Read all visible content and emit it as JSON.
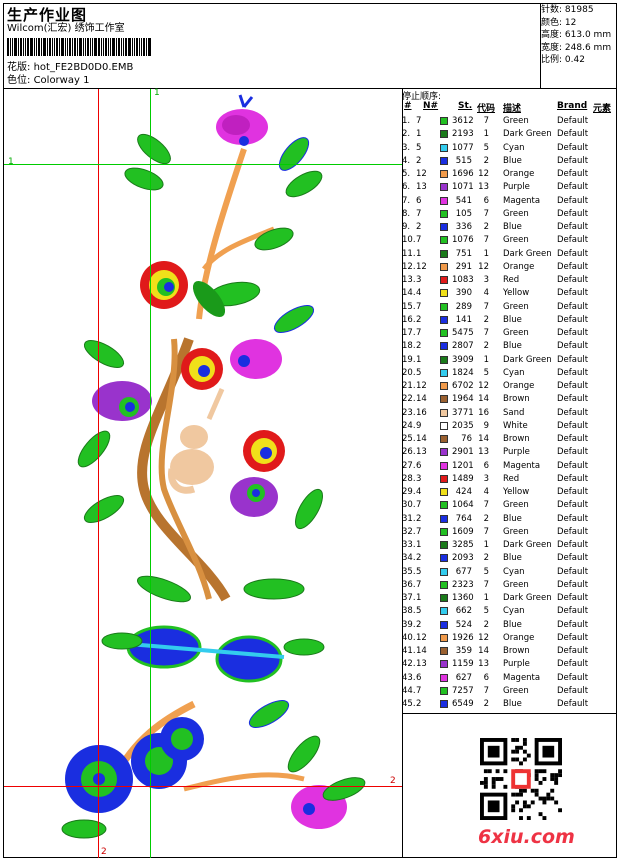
{
  "header": {
    "title": "生产作业图",
    "company": "Wilcom(汇宏) 绣饰工作室",
    "pattern_label": "花版:",
    "pattern_value": "hot_FE2BD0D0.EMB",
    "colorway_label": "色位:",
    "colorway_value": "Colorway 1"
  },
  "stats": [
    {
      "label": "针数:",
      "value": "81985"
    },
    {
      "label": "颜色:",
      "value": "12"
    },
    {
      "label": "高度:",
      "value": "613.0 mm"
    },
    {
      "label": "宽度:",
      "value": "248.6 mm"
    },
    {
      "label": "比例:",
      "value": "0.42"
    }
  ],
  "stop_sequence": {
    "title": "停止顺序:",
    "headers": {
      "num": "#",
      "n": "N#",
      "st": "St.",
      "code": "代码",
      "desc": "描述",
      "brand": "Brand",
      "elem": "元素"
    },
    "rows": [
      [
        "1.",
        "7",
        "3612",
        "7",
        "Green",
        "Default",
        "#22c022"
      ],
      [
        "2.",
        "1",
        "2193",
        "1",
        "Dark Green",
        "Default",
        "#1a7a1a"
      ],
      [
        "3.",
        "5",
        "1077",
        "5",
        "Cyan",
        "Default",
        "#33ccee"
      ],
      [
        "4.",
        "2",
        "515",
        "2",
        "Blue",
        "Default",
        "#1a2ee0"
      ],
      [
        "5.",
        "12",
        "1696",
        "12",
        "Orange",
        "Default",
        "#f09a4a"
      ],
      [
        "6.",
        "13",
        "1071",
        "13",
        "Purple",
        "Default",
        "#9933cc"
      ],
      [
        "7.",
        "6",
        "541",
        "6",
        "Magenta",
        "Default",
        "#e033e0"
      ],
      [
        "8.",
        "7",
        "105",
        "7",
        "Green",
        "Default",
        "#22c022"
      ],
      [
        "9.",
        "2",
        "336",
        "2",
        "Blue",
        "Default",
        "#1a2ee0"
      ],
      [
        "10.",
        "7",
        "1076",
        "7",
        "Green",
        "Default",
        "#22c022"
      ],
      [
        "11.",
        "1",
        "751",
        "1",
        "Dark Green",
        "Default",
        "#1a7a1a"
      ],
      [
        "12.",
        "12",
        "291",
        "12",
        "Orange",
        "Default",
        "#f09a4a"
      ],
      [
        "13.",
        "3",
        "1083",
        "3",
        "Red",
        "Default",
        "#e01a1a"
      ],
      [
        "14.",
        "4",
        "390",
        "4",
        "Yellow",
        "Default",
        "#f0e01a"
      ],
      [
        "15.",
        "7",
        "289",
        "7",
        "Green",
        "Default",
        "#22c022"
      ],
      [
        "16.",
        "2",
        "141",
        "2",
        "Blue",
        "Default",
        "#1a2ee0"
      ],
      [
        "17.",
        "7",
        "5475",
        "7",
        "Green",
        "Default",
        "#22c022"
      ],
      [
        "18.",
        "2",
        "2807",
        "2",
        "Blue",
        "Default",
        "#1a2ee0"
      ],
      [
        "19.",
        "1",
        "3909",
        "1",
        "Dark Green",
        "Default",
        "#1a7a1a"
      ],
      [
        "20.",
        "5",
        "1824",
        "5",
        "Cyan",
        "Default",
        "#33ccee"
      ],
      [
        "21.",
        "12",
        "6702",
        "12",
        "Orange",
        "Default",
        "#f09a4a"
      ],
      [
        "22.",
        "14",
        "1964",
        "14",
        "Brown",
        "Default",
        "#9a6030"
      ],
      [
        "23.",
        "16",
        "3771",
        "16",
        "Sand",
        "Default",
        "#f0c8a0"
      ],
      [
        "24.",
        "9",
        "2035",
        "9",
        "White",
        "Default",
        "#ffffff"
      ],
      [
        "25.",
        "14",
        "76",
        "14",
        "Brown",
        "Default",
        "#9a6030"
      ],
      [
        "26.",
        "13",
        "2901",
        "13",
        "Purple",
        "Default",
        "#9933cc"
      ],
      [
        "27.",
        "6",
        "1201",
        "6",
        "Magenta",
        "Default",
        "#e033e0"
      ],
      [
        "28.",
        "3",
        "1489",
        "3",
        "Red",
        "Default",
        "#e01a1a"
      ],
      [
        "29.",
        "4",
        "424",
        "4",
        "Yellow",
        "Default",
        "#f0e01a"
      ],
      [
        "30.",
        "7",
        "1064",
        "7",
        "Green",
        "Default",
        "#22c022"
      ],
      [
        "31.",
        "2",
        "764",
        "2",
        "Blue",
        "Default",
        "#1a2ee0"
      ],
      [
        "32.",
        "7",
        "1609",
        "7",
        "Green",
        "Default",
        "#22c022"
      ],
      [
        "33.",
        "1",
        "3285",
        "1",
        "Dark Green",
        "Default",
        "#1a7a1a"
      ],
      [
        "34.",
        "2",
        "2093",
        "2",
        "Blue",
        "Default",
        "#1a2ee0"
      ],
      [
        "35.",
        "5",
        "677",
        "5",
        "Cyan",
        "Default",
        "#33ccee"
      ],
      [
        "36.",
        "7",
        "2323",
        "7",
        "Green",
        "Default",
        "#22c022"
      ],
      [
        "37.",
        "1",
        "1360",
        "1",
        "Dark Green",
        "Default",
        "#1a7a1a"
      ],
      [
        "38.",
        "5",
        "662",
        "5",
        "Cyan",
        "Default",
        "#33ccee"
      ],
      [
        "39.",
        "2",
        "524",
        "2",
        "Blue",
        "Default",
        "#1a2ee0"
      ],
      [
        "40.",
        "12",
        "1926",
        "12",
        "Orange",
        "Default",
        "#f09a4a"
      ],
      [
        "41.",
        "14",
        "359",
        "14",
        "Brown",
        "Default",
        "#9a6030"
      ],
      [
        "42.",
        "13",
        "1159",
        "13",
        "Purple",
        "Default",
        "#9933cc"
      ],
      [
        "43.",
        "6",
        "627",
        "6",
        "Magenta",
        "Default",
        "#e033e0"
      ],
      [
        "44.",
        "7",
        "7257",
        "7",
        "Green",
        "Default",
        "#22c022"
      ],
      [
        "45.",
        "2",
        "6549",
        "2",
        "Blue",
        "Default",
        "#1a2ee0"
      ]
    ]
  },
  "guides": {
    "mark1": "1",
    "mark2": "2"
  },
  "watermark": "6xiu.com"
}
